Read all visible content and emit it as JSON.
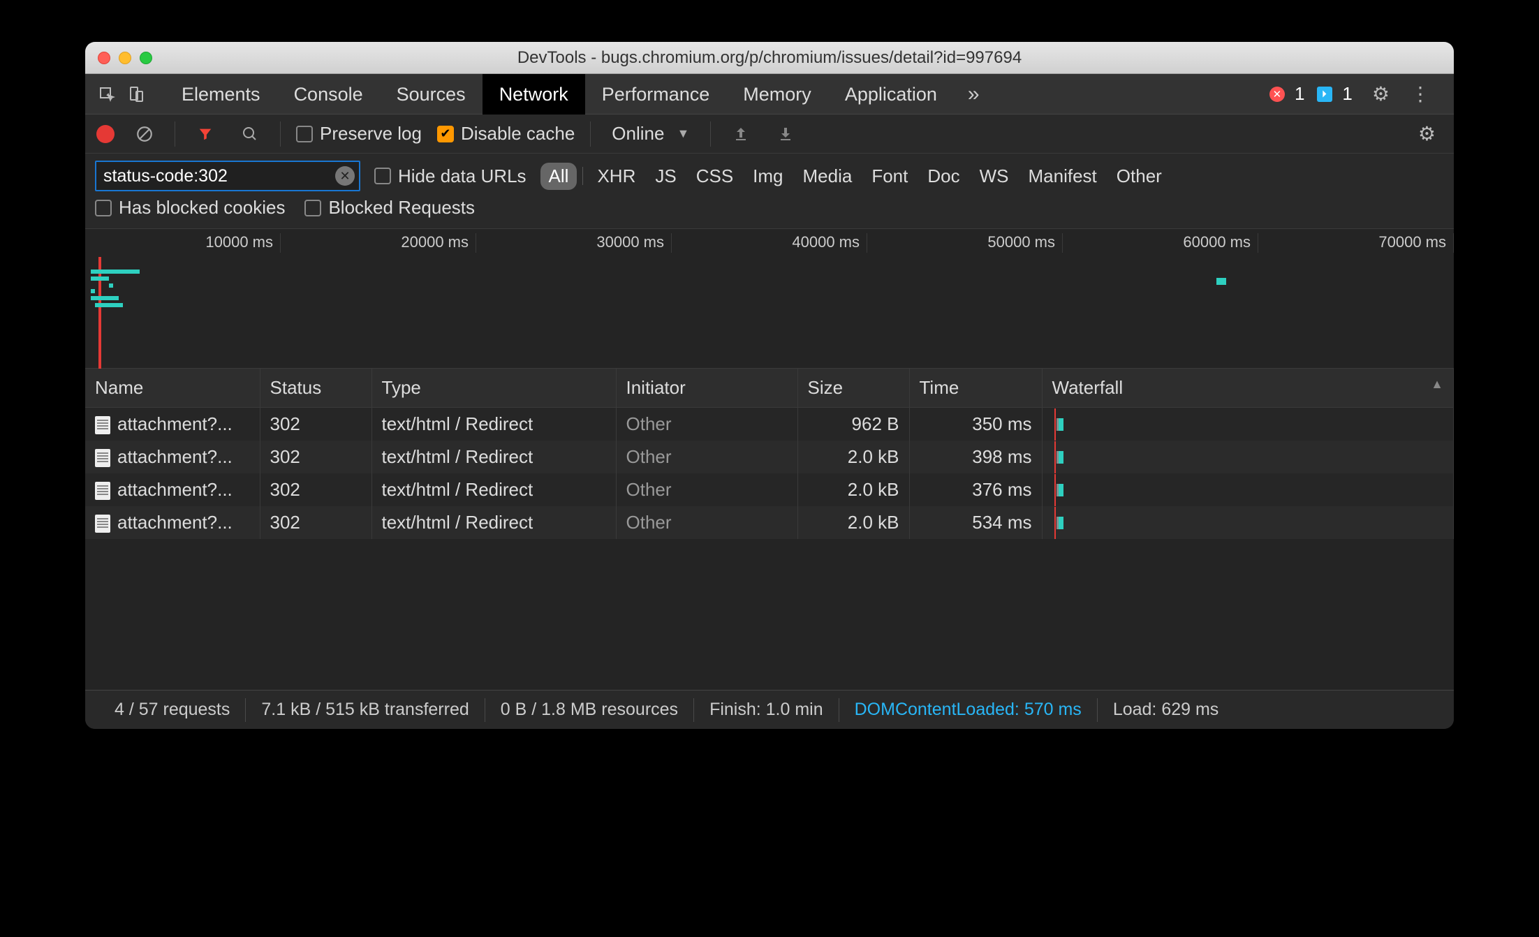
{
  "titlebar": {
    "title": "DevTools - bugs.chromium.org/p/chromium/issues/detail?id=997694"
  },
  "main_tabs": {
    "items": [
      "Elements",
      "Console",
      "Sources",
      "Network",
      "Performance",
      "Memory",
      "Application"
    ],
    "active_index": 3,
    "error_count": "1",
    "info_count": "1"
  },
  "toolbar": {
    "preserve_log_label": "Preserve log",
    "preserve_log_checked": false,
    "disable_cache_label": "Disable cache",
    "disable_cache_checked": true,
    "throttling_value": "Online"
  },
  "filterbar": {
    "filter_value": "status-code:302",
    "hide_data_urls_label": "Hide data URLs",
    "type_filters": [
      "All",
      "XHR",
      "JS",
      "CSS",
      "Img",
      "Media",
      "Font",
      "Doc",
      "WS",
      "Manifest",
      "Other"
    ],
    "active_type_index": 0,
    "has_blocked_cookies_label": "Has blocked cookies",
    "blocked_requests_label": "Blocked Requests"
  },
  "overview": {
    "ticks": [
      "10000 ms",
      "20000 ms",
      "30000 ms",
      "40000 ms",
      "50000 ms",
      "60000 ms",
      "70000 ms"
    ]
  },
  "columns": [
    "Name",
    "Status",
    "Type",
    "Initiator",
    "Size",
    "Time",
    "Waterfall"
  ],
  "requests": [
    {
      "name": "attachment?...",
      "status": "302",
      "type": "text/html / Redirect",
      "initiator": "Other",
      "size": "962 B",
      "time": "350 ms"
    },
    {
      "name": "attachment?...",
      "status": "302",
      "type": "text/html / Redirect",
      "initiator": "Other",
      "size": "2.0 kB",
      "time": "398 ms"
    },
    {
      "name": "attachment?...",
      "status": "302",
      "type": "text/html / Redirect",
      "initiator": "Other",
      "size": "2.0 kB",
      "time": "376 ms"
    },
    {
      "name": "attachment?...",
      "status": "302",
      "type": "text/html / Redirect",
      "initiator": "Other",
      "size": "2.0 kB",
      "time": "534 ms"
    }
  ],
  "statusbar": {
    "requests": "4 / 57 requests",
    "transferred": "7.1 kB / 515 kB transferred",
    "resources": "0 B / 1.8 MB resources",
    "finish": "Finish: 1.0 min",
    "dcl": "DOMContentLoaded: 570 ms",
    "load": "Load: 629 ms"
  }
}
